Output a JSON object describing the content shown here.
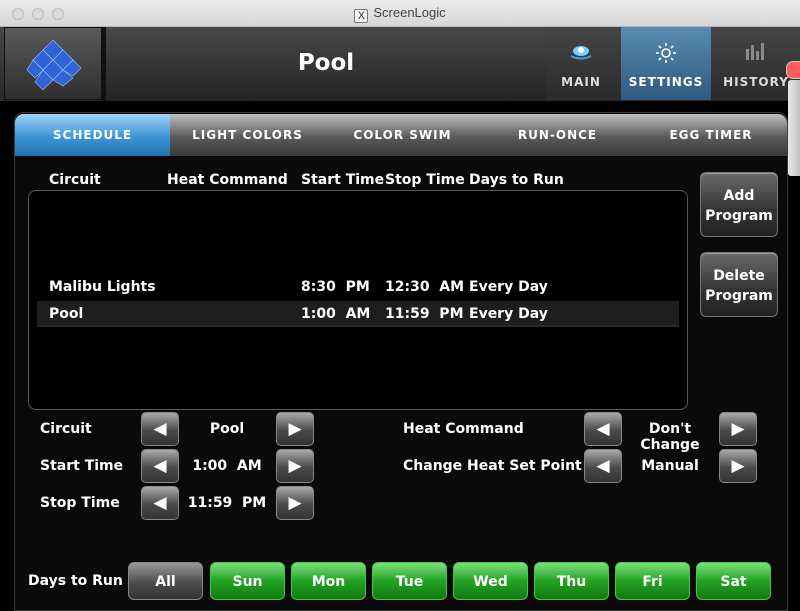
{
  "window": {
    "title": "ScreenLogic",
    "x_badge": "X"
  },
  "header": {
    "title": "Pool",
    "nav": [
      {
        "label": "MAIN",
        "icon": "pool-light-icon"
      },
      {
        "label": "SETTINGS",
        "icon": "gear-icon"
      },
      {
        "label": "HISTORY",
        "icon": "bar-chart-icon"
      }
    ]
  },
  "tabs": [
    "SCHEDULE",
    "LIGHT COLORS",
    "COLOR SWIM",
    "RUN-ONCE",
    "EGG TIMER"
  ],
  "columns": [
    "Circuit",
    "Heat Command",
    "Start Time",
    "Stop Time",
    "Days to Run"
  ],
  "schedule": [
    {
      "circuit": "Malibu Lights",
      "heat": "",
      "start": "8:30  PM",
      "stop": "12:30  AM",
      "days": "Every Day"
    },
    {
      "circuit": "Pool",
      "heat": "",
      "start": "1:00  AM",
      "stop": "11:59  PM",
      "days": "Every Day"
    }
  ],
  "buttons": {
    "add_line1": "Add",
    "add_line2": "Program",
    "delete_line1": "Delete",
    "delete_line2": "Program"
  },
  "form": {
    "circuit_label": "Circuit",
    "circuit_value": "Pool",
    "start_label": "Start Time",
    "start_value": "1:00  AM",
    "stop_label": "Stop Time",
    "stop_value": "11:59  PM",
    "heat_label": "Heat Command",
    "heat_value": "Don't Change",
    "setpoint_label": "Change Heat Set Point",
    "setpoint_value": "Manual"
  },
  "days": {
    "label": "Days to Run",
    "all": "All",
    "items": [
      "Sun",
      "Mon",
      "Tue",
      "Wed",
      "Thu",
      "Fri",
      "Sat"
    ]
  },
  "colors": {
    "accent": "#3c95d6",
    "day_on": "#23a323",
    "close": "#ff5d5d"
  }
}
